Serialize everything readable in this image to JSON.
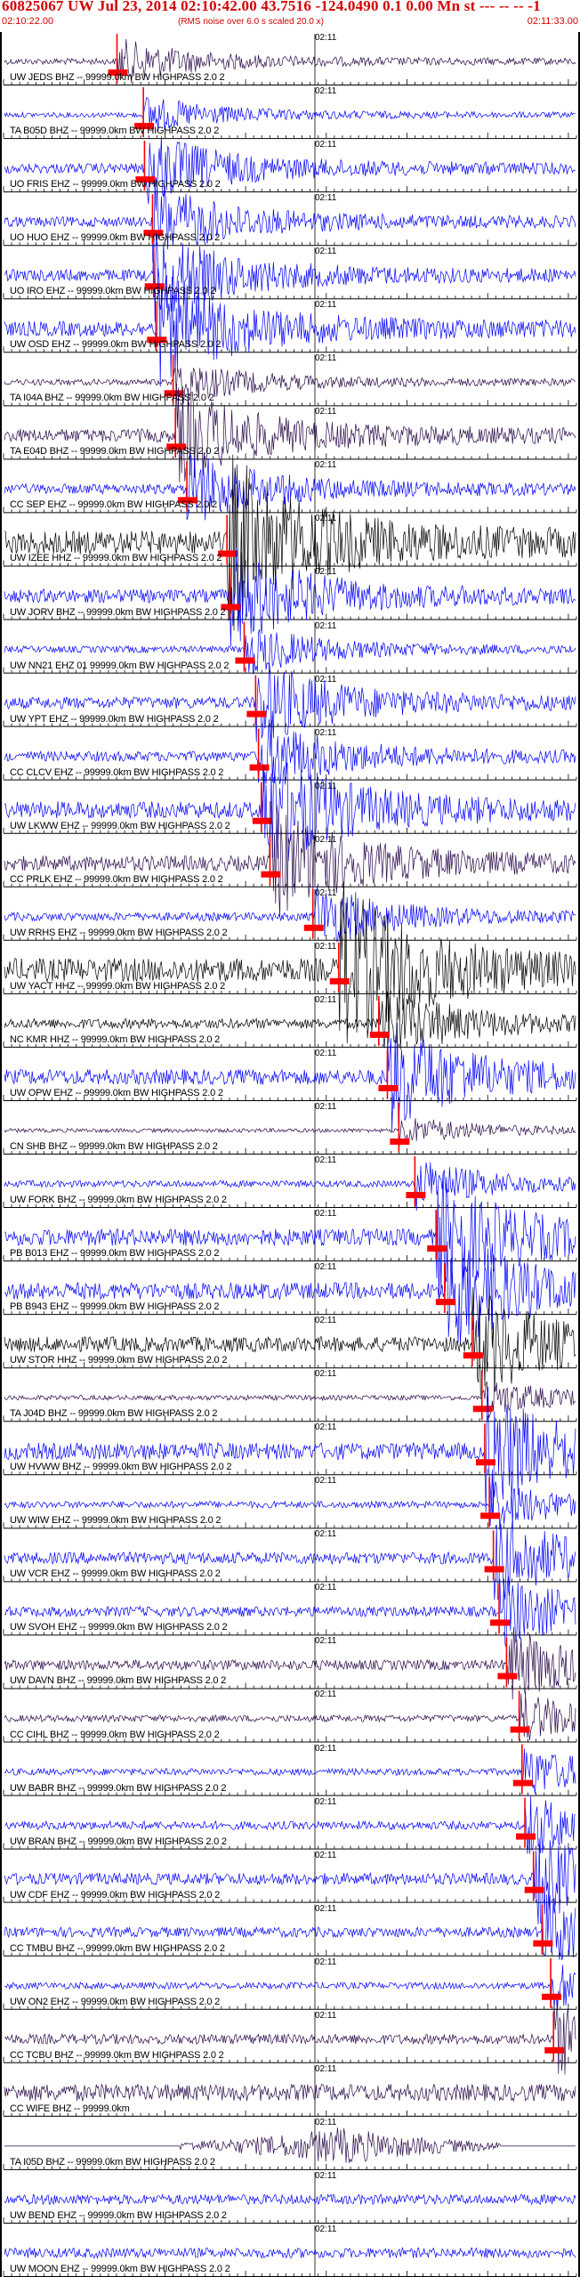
{
  "header": {
    "title": "60825067 UW Jul 23, 2014 02:10:42.00   43.7516 -124.0490  0.1 0.00 Mn st --- -- --  -1",
    "start_time": "02:10:22.00",
    "note": "(RMS noise over 6.0 s scaled 20.0 x)",
    "end_time": "02:11:33.00"
  },
  "minute_tick_label": "02:11",
  "marker_color": "#ff0000",
  "trace_colors": {
    "blue": "#0000ff",
    "black": "#000000",
    "dark": "#2b0a4a"
  },
  "traces": [
    {
      "label": "UW JEDS BHZ -- 99999.0km BW  HIGHPASS  2.0  2",
      "color": "dark",
      "amp": 0.18,
      "pick": 0.198
    },
    {
      "label": "TA B05D BHZ -- 99999.0km BW  HIGHPASS  2.0  2",
      "color": "blue",
      "amp": 0.15,
      "pick": 0.244
    },
    {
      "label": "UO FRIS EHZ -- 99999.0km BW  HIGHPASS  2.0  2",
      "color": "blue",
      "amp": 0.3,
      "pick": 0.246
    },
    {
      "label": "UO HUO EHZ -- 99999.0km BW  HIGHPASS  2.0  2",
      "color": "blue",
      "amp": 0.3,
      "pick": 0.26
    },
    {
      "label": "UO IRO EHZ -- 99999.0km BW  HIGHPASS  2.0  2",
      "color": "blue",
      "amp": 0.35,
      "pick": 0.262
    },
    {
      "label": "UW OSD EHZ -- 99999.0km BW  HIGHPASS  2.0  2",
      "color": "blue",
      "amp": 0.45,
      "pick": 0.266
    },
    {
      "label": "TA I04A BHZ -- 99999.0km BW  HIGHPASS  2.0  2",
      "color": "dark",
      "amp": 0.18,
      "pick": 0.296
    },
    {
      "label": "TA E04D BHZ -- 99999.0km BW  HIGHPASS  2.0  2",
      "color": "dark",
      "amp": 0.4,
      "pick": 0.3
    },
    {
      "label": "CC SEP EHZ -- 99999.0km BW  HIGHPASS  2.0  2",
      "color": "blue",
      "amp": 0.3,
      "pick": 0.32
    },
    {
      "label": "UW IZEE HHZ -- 99999.0km BW  HIGHPASS  2.0  2",
      "color": "black",
      "amp": 0.7,
      "pick": 0.39
    },
    {
      "label": "UW JORV BHZ -- 99999.0km BW  HIGHPASS  2.0  2",
      "color": "blue",
      "amp": 0.4,
      "pick": 0.395
    },
    {
      "label": "UW NN21 EHZ 01 99999.0km BW  HIGHPASS  2.0  2",
      "color": "blue",
      "amp": 0.2,
      "pick": 0.42
    },
    {
      "label": "UW YPT EHZ -- 99999.0km BW  HIGHPASS  2.0  2",
      "color": "blue",
      "amp": 0.35,
      "pick": 0.44
    },
    {
      "label": "CC CLCV EHZ -- 99999.0km BW  HIGHPASS  2.0  2",
      "color": "blue",
      "amp": 0.3,
      "pick": 0.445
    },
    {
      "label": "UW LKWW EHZ -- 99999.0km BW  HIGHPASS  2.0  2",
      "color": "blue",
      "amp": 0.5,
      "pick": 0.45
    },
    {
      "label": "CC PRLK EHZ -- 99999.0km BW  HIGHPASS  2.0  2",
      "color": "dark",
      "amp": 0.45,
      "pick": 0.465
    },
    {
      "label": "UW RRHS EHZ -- 99999.0km BW  HIGHPASS  2.0  2",
      "color": "blue",
      "amp": 0.25,
      "pick": 0.54
    },
    {
      "label": "UW YACT HHZ -- 99999.0km BW  HIGHPASS  2.0  2",
      "color": "black",
      "amp": 0.7,
      "pick": 0.585
    },
    {
      "label": "NC KMR HHZ -- 99999.0km BW  HIGHPASS  2.0  2",
      "color": "black",
      "amp": 0.3,
      "pick": 0.655
    },
    {
      "label": "UW OPW EHZ -- 99999.0km BW  HIGHPASS  2.0  2",
      "color": "blue",
      "amp": 0.45,
      "pick": 0.67
    },
    {
      "label": "CN SHB BHZ -- 99999.0km BW  HIGHPASS  2.0  2",
      "color": "dark",
      "amp": 0.12,
      "pick": 0.69
    },
    {
      "label": "UW FORK BHZ -- 99999.0km BW  HIGHPASS  2.0  2",
      "color": "blue",
      "amp": 0.2,
      "pick": 0.718
    },
    {
      "label": "PB B013 EHZ -- 99999.0km BW  HIGHPASS  2.0  2",
      "color": "blue",
      "amp": 0.5,
      "pick": 0.755
    },
    {
      "label": "PB B943 EHZ -- 99999.0km BW  HIGHPASS  2.0  2",
      "color": "blue",
      "amp": 0.5,
      "pick": 0.77
    },
    {
      "label": "UW STOR HHZ -- 99999.0km BW  HIGHPASS  2.0  2",
      "color": "black",
      "amp": 0.45,
      "pick": 0.818
    },
    {
      "label": "TA J04D BHZ -- 99999.0km BW  HIGHPASS  2.0  2",
      "color": "dark",
      "amp": 0.15,
      "pick": 0.835
    },
    {
      "label": "UW HVWW BHZ -- 99999.0km BW  HIGHPASS  2.0  2",
      "color": "blue",
      "amp": 0.5,
      "pick": 0.84
    },
    {
      "label": "UW WIW EHZ -- 99999.0km BW  HIGHPASS  2.0  2",
      "color": "blue",
      "amp": 0.2,
      "pick": 0.848
    },
    {
      "label": "UW VCR EHZ -- 99999.0km BW  HIGHPASS  2.0  2",
      "color": "blue",
      "amp": 0.35,
      "pick": 0.855
    },
    {
      "label": "UW SVOH EHZ -- 99999.0km BW  HIGHPASS  2.0  2",
      "color": "blue",
      "amp": 0.3,
      "pick": 0.865
    },
    {
      "label": "UW DAVN BHZ -- 99999.0km BW  HIGHPASS  2.0  2",
      "color": "dark",
      "amp": 0.3,
      "pick": 0.878
    },
    {
      "label": "CC CIHL BHZ -- 99999.0km BW  HIGHPASS  2.0  2",
      "color": "dark",
      "amp": 0.2,
      "pick": 0.9
    },
    {
      "label": "UW BABR BHZ -- 99999.0km BW  HIGHPASS  2.0  2",
      "color": "blue",
      "amp": 0.2,
      "pick": 0.905
    },
    {
      "label": "UW BRAN BHZ -- 99999.0km BW  HIGHPASS  2.0  2",
      "color": "blue",
      "amp": 0.25,
      "pick": 0.91
    },
    {
      "label": "UW CDF EHZ -- 99999.0km BW  HIGHPASS  2.0  2",
      "color": "blue",
      "amp": 0.35,
      "pick": 0.925
    },
    {
      "label": "CC TMBU BHZ -- 99999.0km BW  HIGHPASS  2.0  2",
      "color": "blue",
      "amp": 0.3,
      "pick": 0.94
    },
    {
      "label": "UW ON2 EHZ -- 99999.0km BW  HIGHPASS  2.0  2",
      "color": "blue",
      "amp": 0.2,
      "pick": 0.955
    },
    {
      "label": "CC TCBU BHZ -- 99999.0km BW  HIGHPASS  2.0  2",
      "color": "dark",
      "amp": 0.3,
      "pick": 0.96
    },
    {
      "label": "CC WIFE BHZ -- 99999.0km",
      "color": "dark",
      "amp": 0.5,
      "pick": null
    },
    {
      "label": "TA I05D BHZ -- 99999.0km BW  HIGHPASS  2.0  2",
      "color": "dark",
      "amp": 0.0,
      "pick": null
    },
    {
      "label": "UW BEND EHZ -- 99999.0km BW  HIGHPASS  2.0  2",
      "color": "blue",
      "amp": 0.3,
      "pick": null
    },
    {
      "label": "UW MOON EHZ -- 99999.0km BW  HIGHPASS  2.0  2",
      "color": "blue",
      "amp": 0.3,
      "pick": null
    }
  ]
}
